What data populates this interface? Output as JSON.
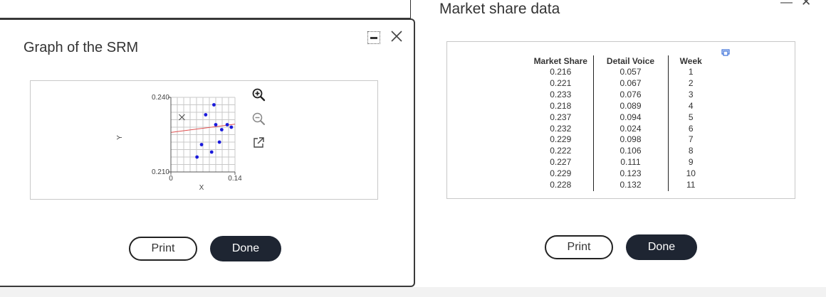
{
  "right_window": {
    "title": "Market share data",
    "top_controls": "—✕",
    "table": {
      "headers": [
        "Market Share",
        "Detail Voice",
        "Week"
      ],
      "rows": [
        [
          "0.216",
          "0.057",
          "1"
        ],
        [
          "0.221",
          "0.067",
          "2"
        ],
        [
          "0.233",
          "0.076",
          "3"
        ],
        [
          "0.218",
          "0.089",
          "4"
        ],
        [
          "0.237",
          "0.094",
          "5"
        ],
        [
          "0.232",
          "0.024",
          "6"
        ],
        [
          "0.229",
          "0.098",
          "7"
        ],
        [
          "0.222",
          "0.106",
          "8"
        ],
        [
          "0.227",
          "0.111",
          "9"
        ],
        [
          "0.229",
          "0.123",
          "10"
        ],
        [
          "0.228",
          "0.132",
          "11"
        ]
      ]
    },
    "print_label": "Print",
    "done_label": "Done"
  },
  "left_window": {
    "title": "Graph of the SRM",
    "print_label": "Print",
    "done_label": "Done"
  },
  "chart_data": {
    "type": "scatter",
    "xlabel": "X",
    "ylabel": "Y",
    "xlim": [
      0,
      0.14
    ],
    "ylim": [
      0.21,
      0.24
    ],
    "x_tick_labels": [
      "0",
      "0.14"
    ],
    "y_tick_labels": [
      "0.240",
      "0.210"
    ],
    "grid": true,
    "points": [
      {
        "x": 0.057,
        "y": 0.216
      },
      {
        "x": 0.067,
        "y": 0.221
      },
      {
        "x": 0.076,
        "y": 0.233
      },
      {
        "x": 0.089,
        "y": 0.218
      },
      {
        "x": 0.094,
        "y": 0.237
      },
      {
        "x": 0.024,
        "y": 0.232
      },
      {
        "x": 0.098,
        "y": 0.229
      },
      {
        "x": 0.106,
        "y": 0.222
      },
      {
        "x": 0.111,
        "y": 0.227
      },
      {
        "x": 0.123,
        "y": 0.229
      },
      {
        "x": 0.132,
        "y": 0.228
      }
    ],
    "highlighted_point": {
      "x": 0.024,
      "y": 0.232
    },
    "fit_line": {
      "x": [
        0,
        0.14
      ],
      "y": [
        0.2259,
        0.2292
      ]
    },
    "colors": {
      "points": "#1a1adb",
      "fit_line": "#e05050",
      "grid": "#c8c8c8",
      "axis": "#555555"
    }
  }
}
